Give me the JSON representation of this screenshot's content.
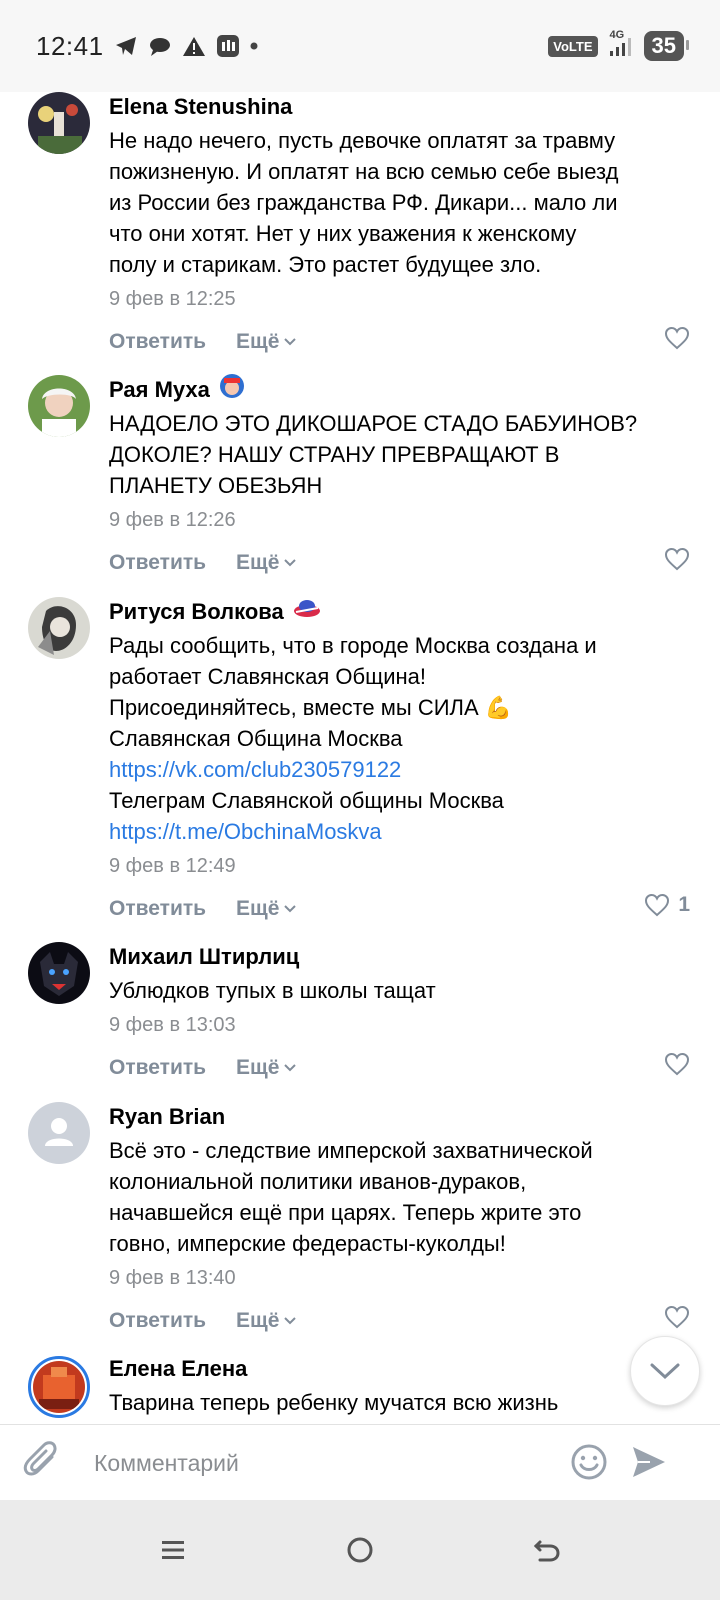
{
  "status_bar": {
    "time": "12:41",
    "icons": [
      "telegram-icon",
      "chat-icon",
      "warning-icon",
      "app-icon",
      "dot-icon"
    ],
    "volte": "VoLTE",
    "network": "4G",
    "battery": "35"
  },
  "comments": [
    {
      "author": "Elena Stenushina",
      "text_lines": [
        "Не надо нечего, пусть девочке оплатят за травму",
        "пожизненую. И оплатят на всю семью себе выезд",
        "из России без гражданства РФ. Дикари... мало ли",
        "что они хотят. Нет у них уважения к женскому",
        "полу и старикам. Это растет будущее зло."
      ],
      "date": "9 фев в 12:25",
      "reply": "Ответить",
      "more": "Ещё",
      "likes": ""
    },
    {
      "author": "Рая Муха",
      "badge": "🧕",
      "text_lines": [
        "НАДОЕЛО ЭТО ДИКОШАРОЕ СТАДО БАБУИНОВ?",
        "ДОКОЛЕ? НАШУ СТРАНУ ПРЕВРАЩАЮТ В",
        "ПЛАНЕТУ ОБЕЗЬЯН"
      ],
      "date": "9 фев в 12:26",
      "reply": "Ответить",
      "more": "Ещё",
      "likes": ""
    },
    {
      "author": "Ритуся Волкова",
      "badge": "👒",
      "text_lines": [
        "Рады сообщить, что в городе Москва создана и",
        "работает Славянская Община!",
        "Присоединяйтесь, вместе мы СИЛА 💪",
        "Славянская Община Москва"
      ],
      "link1": "https://vk.com/club230579122",
      "text_after_link1": "Телеграм Славянской общины Москва",
      "link2": "https://t.me/ObchinaMoskva",
      "date": "9 фев в 12:49",
      "reply": "Ответить",
      "more": "Ещё",
      "likes": "1"
    },
    {
      "author": "Михаил Штирлиц",
      "text_lines": [
        "Ублюдков тупых в школы тащат"
      ],
      "date": "9 фев в 13:03",
      "reply": "Ответить",
      "more": "Ещё",
      "likes": ""
    },
    {
      "author": "Ryan Brian",
      "text_lines": [
        "Всё это - следствие имперской захватнической",
        "колониальной политики иванов-дураков,",
        "начавшейся ещё при царях. Теперь жрите это",
        "говно, имперские федерасты-куколды!"
      ],
      "date": "9 фев в 13:40",
      "reply": "Ответить",
      "more": "Ещё",
      "likes": ""
    },
    {
      "author": "Елена Елена",
      "text_lines": [
        "Тварина теперь ребенку мучатся всю жизнь"
      ]
    }
  ],
  "composer": {
    "placeholder": "Комментарий"
  },
  "colors": {
    "link": "#2a7ae2",
    "secondary": "#818c99",
    "date": "#8a8d91"
  }
}
